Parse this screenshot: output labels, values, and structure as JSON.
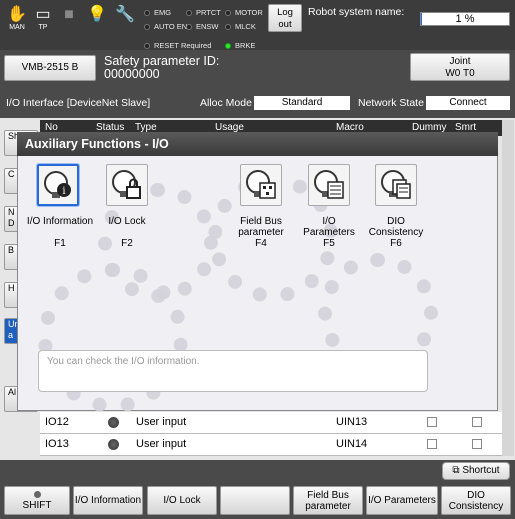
{
  "status_bar": {
    "mode_label": "MAN",
    "tp_label": "TP",
    "leds": [
      {
        "label": "EMG",
        "on": false
      },
      {
        "label": "PRTCT",
        "on": false
      },
      {
        "label": "MOTOR",
        "on": false
      },
      {
        "label": "AUTO EN",
        "on": false
      },
      {
        "label": "ENSW",
        "on": false
      },
      {
        "label": "MLCK",
        "on": false
      }
    ],
    "reset_required": "RESET Required",
    "brke": "BRKE",
    "logout_label": "Log\nout",
    "robot_name_label": "Robot system name:",
    "speed": "1 %",
    "speed_fraction": 0.01
  },
  "header": {
    "model_button": "VMB-2515 B",
    "safety_line1": "Safety parameter ID:",
    "safety_line2": "00000000",
    "joint_line1": "Joint",
    "joint_line2": "W0 T0"
  },
  "interface_bar": {
    "interface_label": "I/O Interface [DeviceNet Slave]",
    "alloc_label": "Alloc Mode",
    "alloc_value": "Standard",
    "network_label": "Network State",
    "network_value": "Connect"
  },
  "table": {
    "headers": [
      "No",
      "Status",
      "Type",
      "Usage",
      "Macro",
      "Dummy",
      "Smrt"
    ],
    "rows": [
      {
        "no": "IO12",
        "type": "User input",
        "macro": "UIN13"
      },
      {
        "no": "IO13",
        "type": "User input",
        "macro": "UIN14"
      }
    ],
    "left_buttons": [
      "Sh",
      "C",
      "N\nD",
      "B",
      "H",
      "Un\na",
      "Al\n"
    ]
  },
  "dialog": {
    "title": "Auxiliary Functions - I/O",
    "functions": [
      {
        "label": "I/O Information",
        "key": "F1",
        "icon": "io-information-icon"
      },
      {
        "label": "I/O Lock",
        "key": "F2",
        "icon": "io-lock-icon"
      },
      {
        "label": "Field Bus\nparameter",
        "key": "F4",
        "icon": "field-bus-icon"
      },
      {
        "label": "I/O\nParameters",
        "key": "F5",
        "icon": "io-parameters-icon"
      },
      {
        "label": "DIO\nConsistency",
        "key": "F6",
        "icon": "dio-consistency-icon"
      }
    ],
    "message": "You can check the I/O information."
  },
  "bottom": {
    "shortcut": "Shortcut",
    "shift": "SHIFT",
    "f1": "I/O Information",
    "f2": "I/O Lock",
    "f3": "",
    "f4": "Field Bus\nparameter",
    "f5": "I/O Parameters",
    "f6": "DIO\nConsistency"
  }
}
